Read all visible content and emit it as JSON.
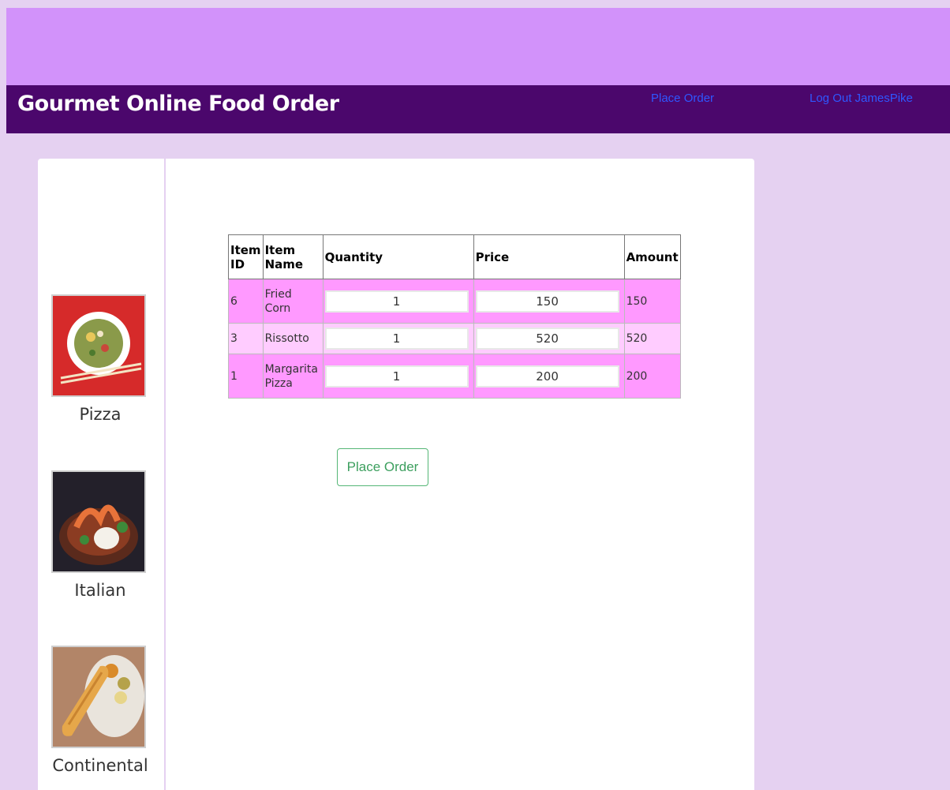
{
  "header": {
    "title": "Gourmet Online Food Order",
    "nav_place_order": "Place Order",
    "nav_logout": "Log Out JamesPike"
  },
  "sidebar": {
    "categories": [
      {
        "label": "Pizza"
      },
      {
        "label": "Italian"
      },
      {
        "label": "Continental"
      }
    ]
  },
  "order_table": {
    "headers": {
      "item_id": "Item ID",
      "item_name": "Item Name",
      "quantity": "Quantity",
      "price": "Price",
      "amount": "Amount"
    },
    "rows": [
      {
        "id": "6",
        "name": "Fried Corn",
        "quantity": "1",
        "price": "150",
        "amount": "150"
      },
      {
        "id": "3",
        "name": "Rissotto",
        "quantity": "1",
        "price": "520",
        "amount": "520"
      },
      {
        "id": "1",
        "name": "Margarita Pizza",
        "quantity": "1",
        "price": "200",
        "amount": "200"
      }
    ]
  },
  "actions": {
    "place_order_label": "Place Order"
  },
  "colors": {
    "top_band": "#d292fa",
    "header": "#4b076c",
    "background": "#e5d1f1",
    "row_dark": "#ff99ff",
    "row_light": "#ffccff",
    "button_green": "#3c9f5e"
  }
}
